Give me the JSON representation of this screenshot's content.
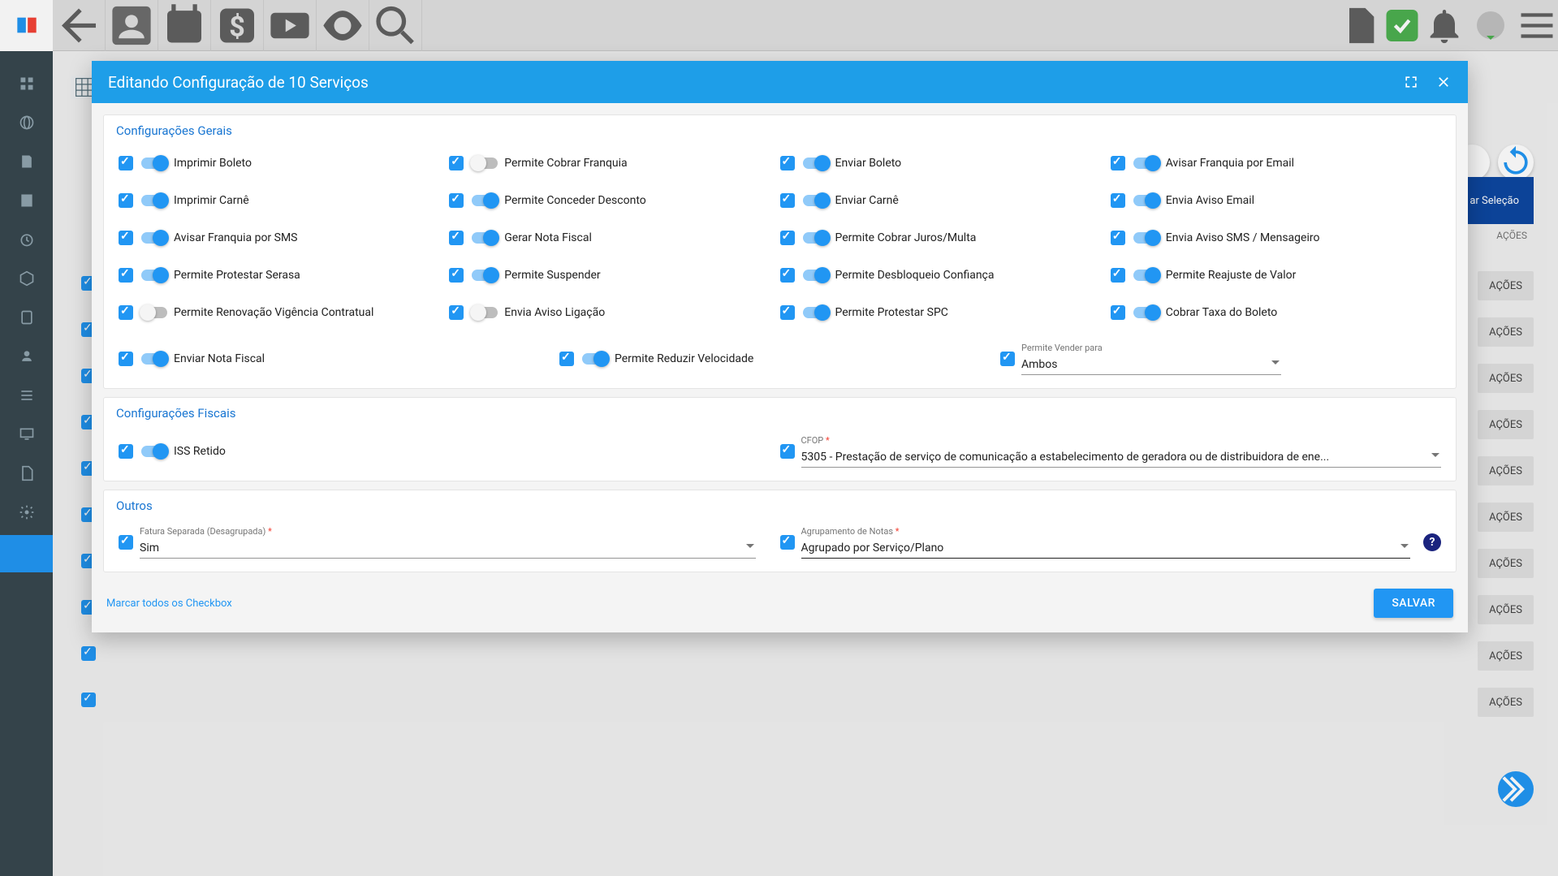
{
  "modal": {
    "title": "Editando Configuração de 10 Serviços",
    "sections": {
      "general": {
        "title": "Configurações Gerais"
      },
      "fiscal": {
        "title": "Configurações Fiscais"
      },
      "other": {
        "title": "Outros"
      }
    },
    "opts": {
      "imprimir_boleto": "Imprimir Boleto",
      "permite_cobrar_franquia": "Permite Cobrar Franquia",
      "enviar_boleto": "Enviar Boleto",
      "avisar_franquia_email": "Avisar Franquia por Email",
      "imprimir_carne": "Imprimir Carnê",
      "permite_conceder_desconto": "Permite Conceder Desconto",
      "enviar_carne": "Enviar Carnê",
      "envia_aviso_email": "Envia Aviso Email",
      "avisar_franquia_sms": "Avisar Franquia por SMS",
      "gerar_nota_fiscal": "Gerar Nota Fiscal",
      "permite_cobrar_juros": "Permite Cobrar Juros/Multa",
      "envia_aviso_sms": "Envia Aviso SMS / Mensageiro",
      "permite_protestar_serasa": "Permite Protestar Serasa",
      "permite_suspender": "Permite Suspender",
      "permite_desbloqueio": "Permite Desbloqueio Confiança",
      "permite_reajuste": "Permite Reajuste de Valor",
      "permite_renovacao": "Permite Renovação Vigência Contratual",
      "envia_aviso_ligacao": "Envia Aviso Ligação",
      "permite_protestar_spc": "Permite Protestar SPC",
      "cobrar_taxa_boleto": "Cobrar Taxa do Boleto",
      "enviar_nota_fiscal": "Enviar Nota Fiscal",
      "permite_reduzir_velocidade": "Permite Reduzir Velocidade",
      "iss_retido": "ISS Retido"
    },
    "selects": {
      "permite_vender": {
        "label": "Permite Vender para",
        "value": "Ambos"
      },
      "cfop": {
        "label": "CFOP",
        "value": "5305 - Prestação de serviço de comunicação a estabelecimento de geradora ou de distribuidora de ene..."
      },
      "fatura_separada": {
        "label": "Fatura Separada (Desagrupada)",
        "value": "Sim"
      },
      "agrupamento_notas": {
        "label": "Agrupamento de Notas",
        "value": "Agrupado por Serviço/Plano"
      }
    },
    "footer": {
      "check_all": "Marcar todos os Checkbox",
      "save": "SALVAR"
    }
  },
  "bg": {
    "limpar_selecao": "ar Seleção",
    "acoes_header": "AÇÕES",
    "acoes_btn": "AÇÕES"
  }
}
